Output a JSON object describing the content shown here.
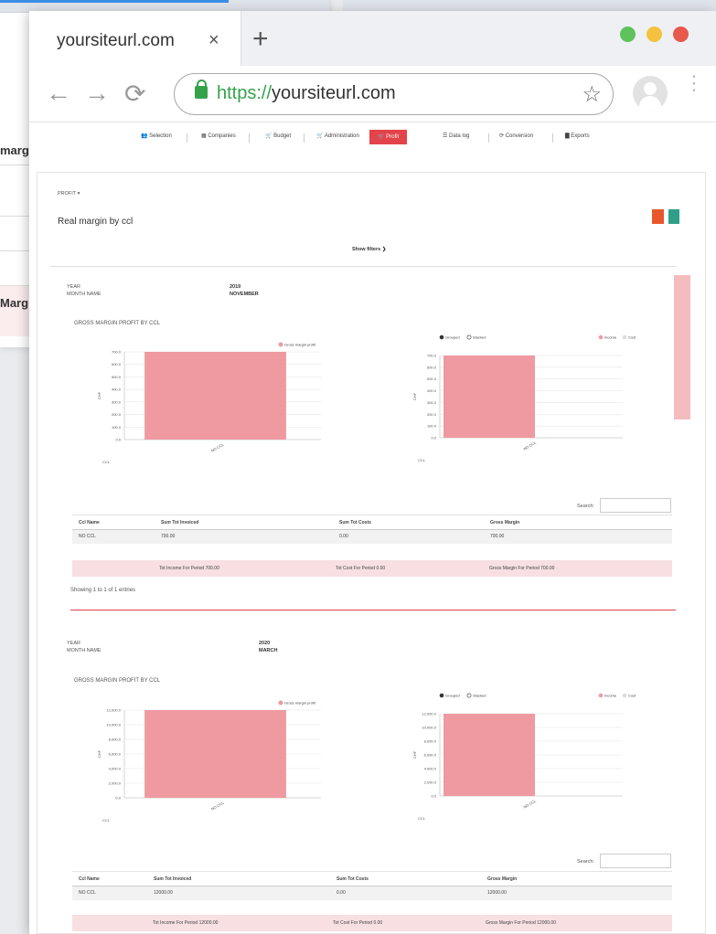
{
  "browser": {
    "tab_title": "yoursiteurl.com",
    "tab_close": "×",
    "new_tab": "+",
    "url_scheme": "https://",
    "url_host": "yoursiteurl.com",
    "back": "←",
    "forward": "→",
    "reload": "⟳",
    "bookmark": "☆",
    "menu": "⋮",
    "traffic_colors": [
      "#5ec35b",
      "#f4c240",
      "#e8584c"
    ]
  },
  "background_window": {
    "labels": [
      "marg",
      "Marg"
    ]
  },
  "menu": [
    {
      "icon": "users-icon",
      "label": "Selection"
    },
    {
      "icon": "building-icon",
      "label": "Companies"
    },
    {
      "icon": "cart-icon",
      "label": "Budget"
    },
    {
      "icon": "cart-icon",
      "label": "Administration"
    },
    {
      "icon": "cart-icon",
      "label": "Profit",
      "active": true
    },
    {
      "icon": "list-icon",
      "label": "Data log"
    },
    {
      "icon": "refresh-icon",
      "label": "Conversion"
    },
    {
      "icon": "file-icon",
      "label": "Exports"
    }
  ],
  "page": {
    "breadcrumb": "PROFIT ▾",
    "title": "Real margin by ccl",
    "show_filters": "Show filters ❯",
    "accent": "#e3434a"
  },
  "sections": [
    {
      "year_label": "YEAR",
      "month_label": "MONTH NAME",
      "year": "2019",
      "month": "NOVEMBER",
      "chart_title": "GROSS MARGIN PROFIT BY CCL",
      "table": {
        "search_label": "Search:",
        "headers": [
          "Ccl Name",
          "Sum Tot Invoiced",
          "Sum Tot Costs",
          "Gross Margin"
        ],
        "rows": [
          [
            "NO CCL",
            "700.00",
            "0.00",
            "700.00"
          ]
        ],
        "totals": [
          "Tot Income For Period 700.00",
          "Tot Cost For Period 0.00",
          "Gross Margin For Period 700.00"
        ],
        "info": "Showing 1 to 1 of 1 entries"
      }
    },
    {
      "year_label": "YEAR",
      "month_label": "MONTH NAME",
      "year": "2020",
      "month": "MARCH",
      "chart_title": "GROSS MARGIN PROFIT BY CCL",
      "table": {
        "search_label": "Search:",
        "headers": [
          "Ccl Name",
          "Sum Tot Invoiced",
          "Sum Tot Costs",
          "Gross Margin"
        ],
        "rows": [
          [
            "NO CCL",
            "12000.00",
            "0.00",
            "12000.00"
          ]
        ],
        "totals": [
          "Tot Income For Period 12000.00",
          "Tot Cost For Period 0.00",
          "Gross Margin For Period 12000.00"
        ],
        "info": ""
      }
    }
  ],
  "chart_data": [
    {
      "type": "bar",
      "categories": [
        "NO CCL"
      ],
      "series": [
        {
          "name": "Gross margin profit",
          "values": [
            700
          ],
          "color": "#ee9aa0"
        }
      ],
      "xlabel": "CCL",
      "ylabel": "CHF",
      "yticks": [
        "0.0",
        "100.0",
        "200.0",
        "300.0",
        "400.0",
        "500.0",
        "600.0",
        "700.0"
      ],
      "ylim": [
        0,
        700
      ],
      "grid": true,
      "legend": "top-right"
    },
    {
      "type": "bar",
      "categories": [
        "NO CCL"
      ],
      "series": [
        {
          "name": "Income",
          "values": [
            700
          ],
          "color": "#ee9aa0"
        },
        {
          "name": "Cost",
          "values": [
            0
          ],
          "color": "#dddddd"
        }
      ],
      "xlabel": "CCL",
      "ylabel": "CHF",
      "yticks": [
        "0.0",
        "100.0",
        "200.0",
        "300.0",
        "400.0",
        "500.0",
        "600.0",
        "700.0"
      ],
      "ylim": [
        0,
        700
      ],
      "grid": true,
      "legend": "top-right",
      "toggle": [
        "Grouped",
        "Stacked"
      ]
    },
    {
      "type": "bar",
      "categories": [
        "NO CCL"
      ],
      "series": [
        {
          "name": "Gross margin profit",
          "values": [
            12000
          ],
          "color": "#ee9aa0"
        }
      ],
      "xlabel": "CCL",
      "ylabel": "CHF",
      "yticks": [
        "0.0",
        "2,000.0",
        "4,000.0",
        "6,000.0",
        "8,000.0",
        "10,000.0",
        "12,000.0"
      ],
      "ylim": [
        0,
        12000
      ],
      "grid": true,
      "legend": "top-right"
    },
    {
      "type": "bar",
      "categories": [
        "NO CCL"
      ],
      "series": [
        {
          "name": "Income",
          "values": [
            12000
          ],
          "color": "#ee9aa0"
        },
        {
          "name": "Cost",
          "values": [
            0
          ],
          "color": "#dddddd"
        }
      ],
      "xlabel": "CCL",
      "ylabel": "CHF",
      "yticks": [
        "0.0",
        "2,000.0",
        "4,000.0",
        "6,000.0",
        "8,000.0",
        "10,000.0",
        "12,000.0"
      ],
      "ylim": [
        0,
        12000
      ],
      "grid": true,
      "legend": "top-right",
      "toggle": [
        "Grouped",
        "Stacked"
      ]
    }
  ]
}
